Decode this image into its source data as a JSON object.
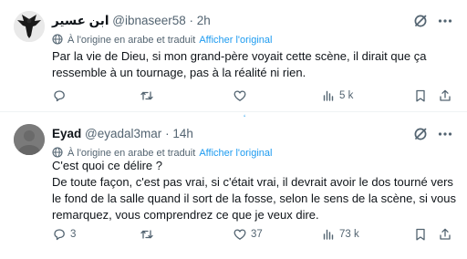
{
  "tweets": [
    {
      "display_name": "ابن عسير",
      "handle": "@ibnaseer58",
      "separator": "·",
      "time": "2h",
      "translation_note": "À l'origine en arabe et traduit",
      "translation_link": "Afficher l'original",
      "text": "Par la vie de Dieu, si mon grand-père voyait cette scène, il dirait que ça ressemble à un tournage, pas à la réalité ni rien.",
      "replies": "",
      "retweets": "",
      "likes": "",
      "views": "5 k"
    },
    {
      "display_name": "Eyad",
      "handle": "@eyadal3mar",
      "separator": "·",
      "time": "14h",
      "translation_note": "À l'origine en arabe et traduit",
      "translation_link": "Afficher l'original",
      "text": "C'est quoi ce délire ?\nDe toute façon, c'est pas vrai, si c'était vrai, il devrait avoir le dos tourné vers le fond de la salle quand il sort de la fosse, selon le sens de la scène, si vous remarquez, vous comprendrez ce que je veux dire.",
      "replies": "3",
      "retweets": "",
      "likes": "37",
      "views": "73 k"
    }
  ],
  "stray_mark": "ʻ",
  "colors": {
    "text": "#0f1419",
    "secondary": "#536471",
    "link": "#1d9bf0",
    "divider": "#eff3f4"
  },
  "icons": [
    "grok-icon",
    "more-icon",
    "globe-icon",
    "reply-icon",
    "retweet-icon",
    "like-icon",
    "views-icon",
    "bookmark-icon",
    "share-icon"
  ]
}
